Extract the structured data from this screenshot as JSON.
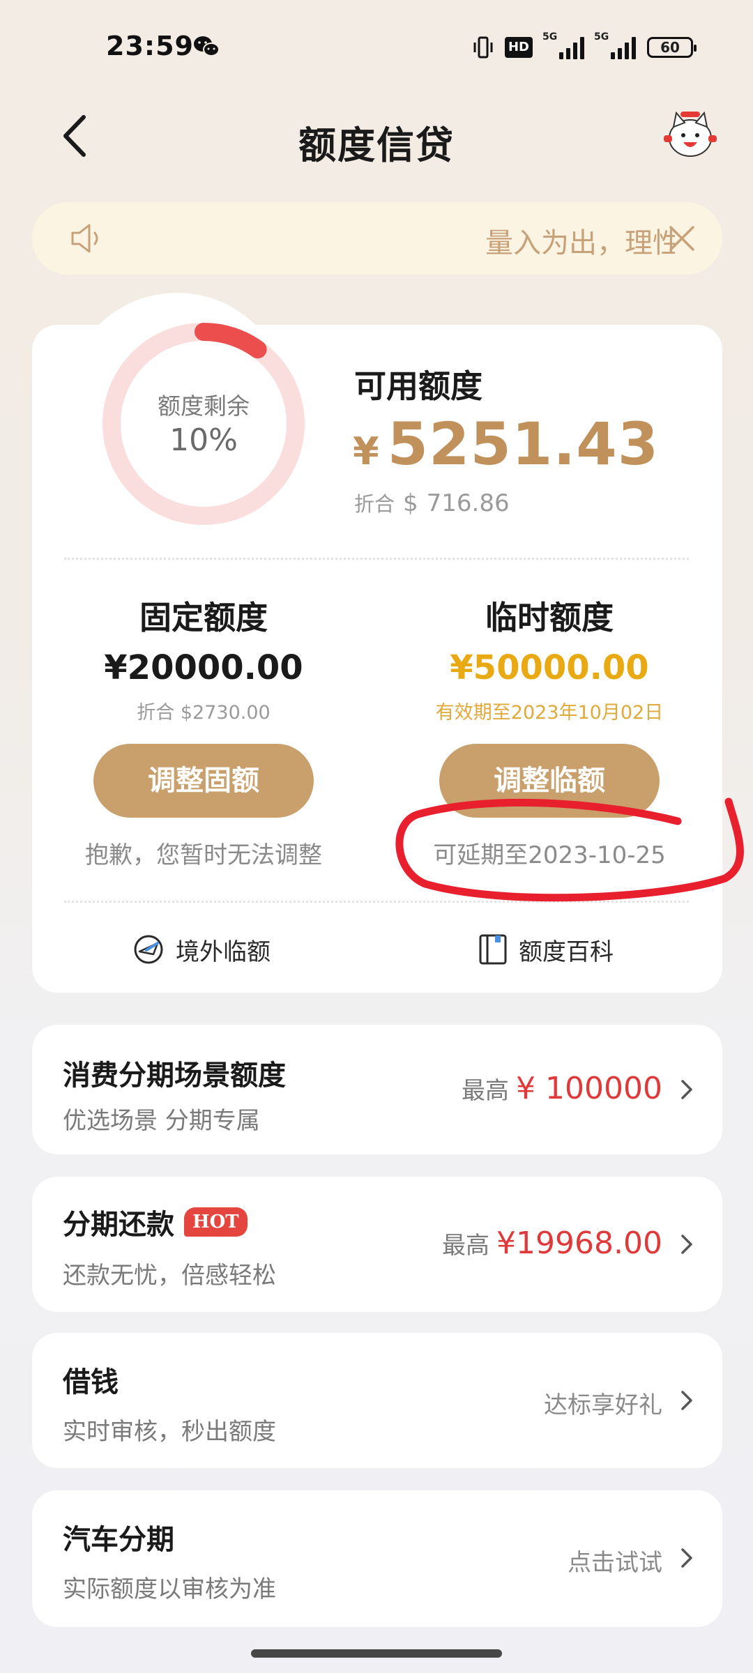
{
  "status_bar": {
    "time": "23:59",
    "network_labels": [
      "5G",
      "5G"
    ],
    "hd_label": "HD",
    "battery": "60"
  },
  "header": {
    "title": "额度信贷"
  },
  "notice": {
    "text": "量入为出，理性消费"
  },
  "summary": {
    "ring_label": "额度剩余",
    "ring_value": "10%",
    "ring_fraction": 0.1,
    "available_title": "可用额度",
    "currency": "¥",
    "available_amount": "5251.43",
    "converted_prefix": "折合",
    "converted_currency": "$",
    "converted_amount": "716.86"
  },
  "fixed_limit": {
    "title": "固定额度",
    "amount": "¥20000.00",
    "sub": "折合 $2730.00",
    "button": "调整固额",
    "note": "抱歉，您暂时无法调整"
  },
  "temp_limit": {
    "title": "临时额度",
    "amount": "¥50000.00",
    "sub": "有效期至2023年10月02日",
    "button": "调整临额",
    "note": "可延期至2023-10-25"
  },
  "links": {
    "overseas": "境外临额",
    "wiki": "额度百科"
  },
  "list": [
    {
      "title": "消费分期场景额度",
      "sub": "优选场景 分期专属",
      "prefix": "最高",
      "amount": "¥ 100000"
    },
    {
      "title": "分期还款",
      "badge": "HOT",
      "sub": "还款无忧，倍感轻松",
      "prefix": "最高",
      "amount": "¥19968.00"
    },
    {
      "title": "借钱",
      "sub": "实时审核，秒出额度",
      "right_text": "达标享好礼"
    },
    {
      "title": "汽车分期",
      "sub": "实际额度以审核为准",
      "right_text": "点击试试"
    }
  ],
  "colors": {
    "gold": "#c1915c",
    "button": "#c9a06c",
    "temp_amount": "#e8a913",
    "red": "#e0393a",
    "ring_track": "#fadedd",
    "ring_fill": "#ec4d4d",
    "annotation": "#e8202e"
  }
}
